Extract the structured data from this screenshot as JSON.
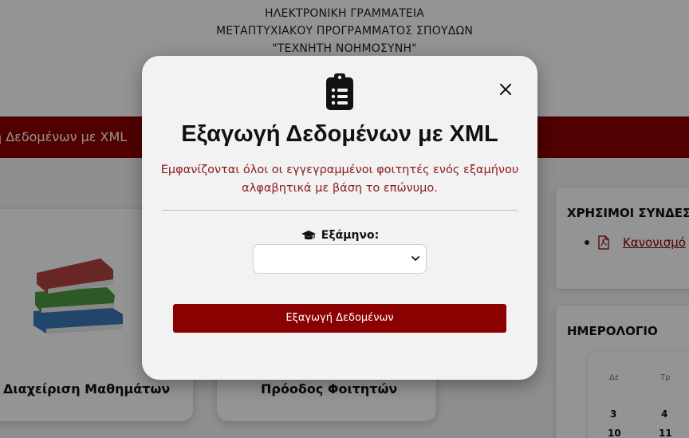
{
  "header": {
    "line1": "ΗΛΕΚΤΡΟΝΙΚΗ ΓΡΑΜΜΑΤΕΙΑ",
    "line2": "ΜΕΤΑΠΤΥΧΙΑΚΟΥ ΠΡΟΓΡΑΜΜΑΤΟΣ ΣΠΟΥΔΩΝ",
    "line3": "\"ΤΕΧΝΗΤΗ ΝΟΗΜΟΣΥΝΗ\""
  },
  "navbar": {
    "text": "ή Δεδομένων με XML"
  },
  "cards": {
    "courses": "Διαχείριση Μαθημάτων",
    "progress": "Πρόοδος Φοιτητών"
  },
  "sidebar": {
    "links_title": "ΧΡΗΣΙΜΟΙ ΣΥΝΔΕΣ",
    "link_1": "Κανονισμό",
    "calendar_title": "ΗΜΕΡΟΛΟΓΙΟ",
    "calendar": {
      "day_1": "Δε",
      "day_2": "Τρ",
      "row1": [
        "3",
        "4"
      ],
      "row2": [
        "10",
        "11"
      ]
    }
  },
  "modal": {
    "icon": "clipboard-list-icon",
    "title": "Εξαγωγή Δεδομένων με XML",
    "desc_line1": "Εμφανίζονται όλοι οι εγγεγραμμένοι φοιτητές ενός εξαμήνου",
    "desc_line2": "αλφαβητικά με βάση το επώνυμο.",
    "field_label": "Εξάμηνο:",
    "field_icon": "graduation-cap-icon",
    "select_value": "",
    "button_label": "Εξαγωγή Δεδομένων",
    "close_icon": "close-icon"
  },
  "colors": {
    "brand": "#8b0000",
    "description_text": "#8b1a1a",
    "modal_bg": "#f2f2f2"
  }
}
